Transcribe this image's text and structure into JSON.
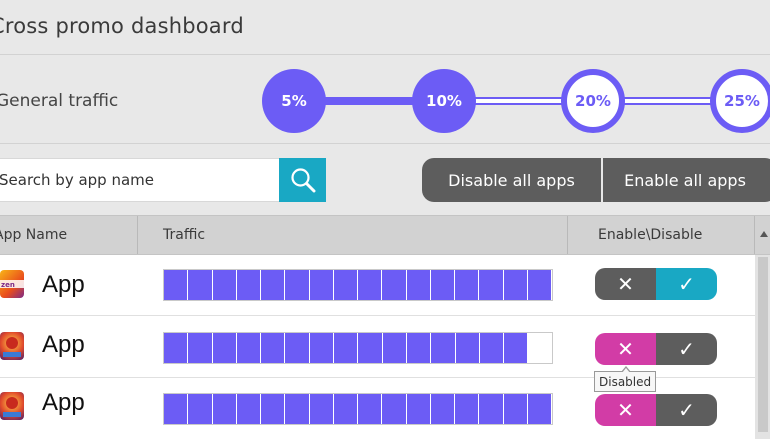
{
  "header": {
    "title": "Cross promo dashboard"
  },
  "traffic": {
    "label": "General traffic",
    "steps": [
      {
        "label": "5%",
        "active": true
      },
      {
        "label": "10%",
        "active": true
      },
      {
        "label": "20%",
        "active": false
      },
      {
        "label": "25%",
        "active": false
      }
    ]
  },
  "search": {
    "placeholder": "Search by app name",
    "value": "",
    "icon": "search-icon"
  },
  "actions": {
    "disable_all": "Disable all apps",
    "enable_all": "Enable all apps"
  },
  "table": {
    "columns": [
      "App Name",
      "Traffic",
      "Enable\\Disable"
    ],
    "rows": [
      {
        "name": "App",
        "traffic_segments": 16,
        "traffic_total": 16,
        "state": "enabled",
        "off_glyph": "✕",
        "on_glyph": "✓"
      },
      {
        "name": "App",
        "traffic_segments": 15,
        "traffic_total": 16,
        "state": "disabled",
        "off_glyph": "✕",
        "on_glyph": "✓"
      },
      {
        "name": "App",
        "traffic_segments": 16,
        "traffic_total": 16,
        "state": "disabled",
        "off_glyph": "✕",
        "on_glyph": "✓"
      }
    ]
  },
  "tooltip": {
    "text": "Disabled"
  },
  "colors": {
    "accent": "#6c5cf5",
    "search_button": "#19a8c4",
    "toggle_off_active": "#d23ca6",
    "toggle_on_active": "#19a8c4",
    "toggle_inactive": "#5d5d5d"
  }
}
